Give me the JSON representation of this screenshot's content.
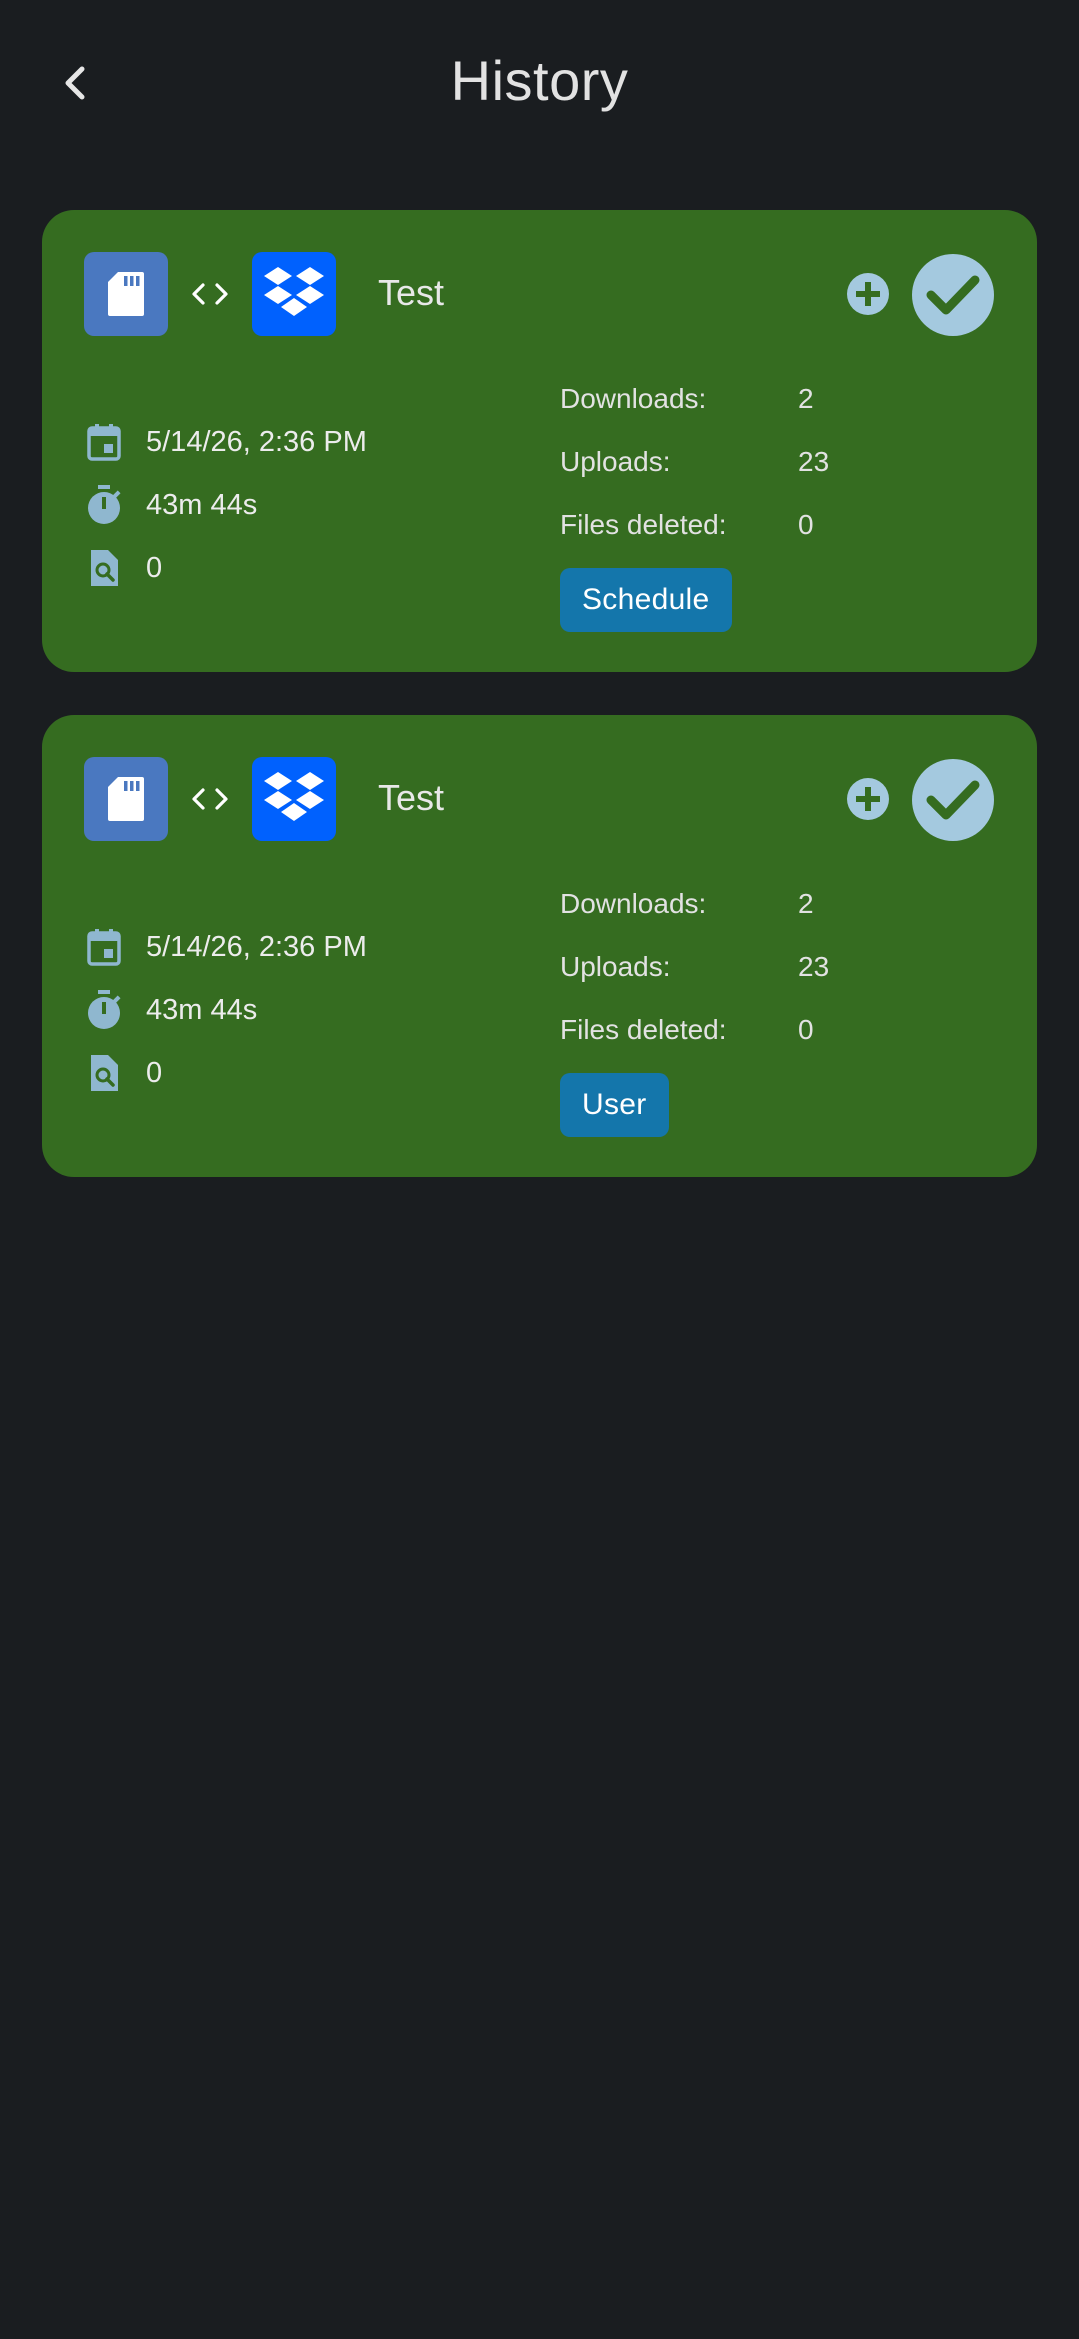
{
  "header": {
    "title": "History",
    "back_icon": "chevron-left-icon"
  },
  "colors": {
    "background": "#1a1d20",
    "card": "#356c20",
    "source_tile": "#4a78c0",
    "dropbox_tile": "#0061fe",
    "status_circle": "#a4c9df",
    "chip": "#1476ab",
    "icon_tint": "#8fb7cf"
  },
  "labels": {
    "downloads": "Downloads:",
    "uploads": "Uploads:",
    "files_deleted": "Files deleted:"
  },
  "history": [
    {
      "name": "Test",
      "source_icon": "sd-card-icon",
      "sync_icon": "code-arrows-icon",
      "destination_icon": "dropbox-icon",
      "status": "success",
      "date": "5/14/26, 2:36 PM",
      "duration": "43m 44s",
      "scanned": "0",
      "downloads": "2",
      "uploads": "23",
      "files_deleted": "0",
      "trigger": "Schedule"
    },
    {
      "name": "Test",
      "source_icon": "sd-card-icon",
      "sync_icon": "code-arrows-icon",
      "destination_icon": "dropbox-icon",
      "status": "success",
      "date": "5/14/26, 2:36 PM",
      "duration": "43m 44s",
      "scanned": "0",
      "downloads": "2",
      "uploads": "23",
      "files_deleted": "0",
      "trigger": "User"
    }
  ]
}
